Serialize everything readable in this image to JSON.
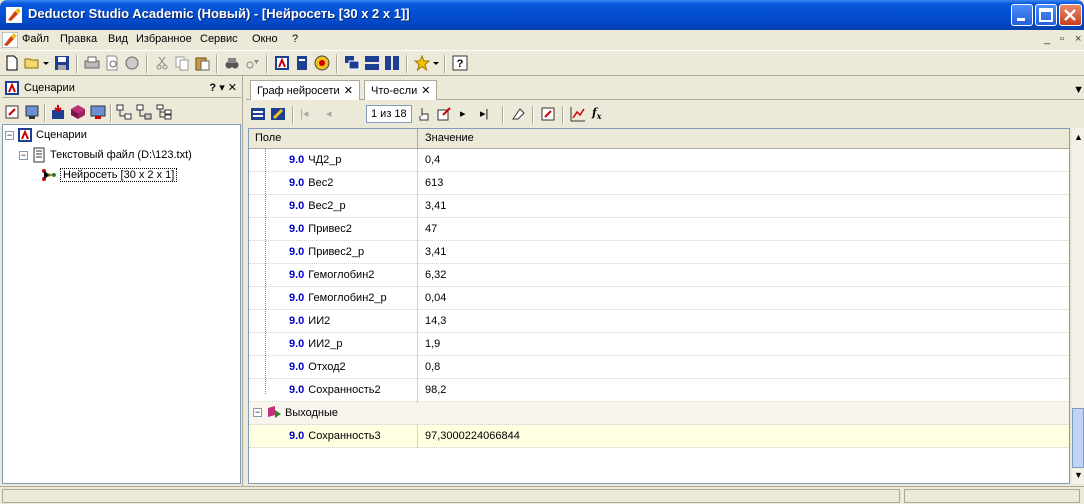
{
  "window": {
    "title": "Deductor Studio Academic (Новый) - [Нейросеть [30 x 2 x 1]]"
  },
  "menu": {
    "items": [
      "Файл",
      "Правка",
      "Вид",
      "Избранное",
      "Сервис",
      "Окно",
      "?"
    ]
  },
  "left_panel": {
    "title": "Сценарии",
    "controls": "? ▾ ✕",
    "tree": {
      "root": "Сценарии",
      "child": "Текстовый файл (D:\\123.txt)",
      "leaf": "Нейросеть [30 x 2 x 1]"
    }
  },
  "right_panel": {
    "tabs": [
      {
        "label": "Граф нейросети"
      },
      {
        "label": "Что-если"
      }
    ],
    "page_counter": "1 из 18",
    "grid": {
      "columns": [
        "Поле",
        "Значение"
      ],
      "type_label": "9.0",
      "rows": [
        {
          "field": "ЧД2_р",
          "value": "0,4"
        },
        {
          "field": "Вес2",
          "value": "613"
        },
        {
          "field": "Вес2_р",
          "value": "3,41"
        },
        {
          "field": "Привес2",
          "value": "47"
        },
        {
          "field": "Привес2_р",
          "value": "3,41"
        },
        {
          "field": "Гемоглобин2",
          "value": "6,32"
        },
        {
          "field": "Гемоглобин2_р",
          "value": "0,04"
        },
        {
          "field": "ИИ2",
          "value": "14,3"
        },
        {
          "field": "ИИ2_р",
          "value": "1,9"
        },
        {
          "field": "Отход2",
          "value": "0,8"
        },
        {
          "field": "Сохранность2",
          "value": "98,2"
        }
      ],
      "group": "Выходные",
      "output_row": {
        "field": "Сохранность3",
        "value": "97,3000224066844"
      }
    }
  },
  "colors": {
    "title_bar": "#0450d6",
    "type_label": "#0000cc",
    "highlight": "#ffffe1"
  }
}
